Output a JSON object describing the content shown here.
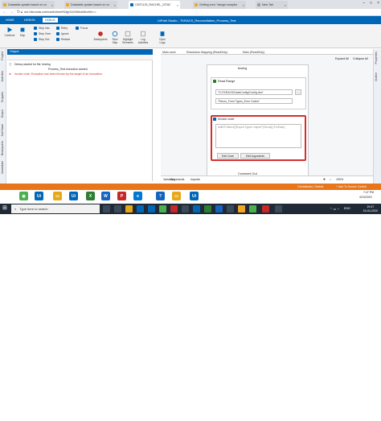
{
  "browser": {
    "tabs": [
      {
        "title": "Datatable update based on co"
      },
      {
        "title": "Datatable update based on co"
      },
      {
        "title": "CMT1125_RACHEL_23782"
      },
      {
        "title": "Getting error \"assign exceptio"
      },
      {
        "title": "New Tab"
      }
    ],
    "url": "ra1.hitconda.com/ca/#/client/N3gGAGMAdzBzcWx=="
  },
  "studio": {
    "ribbon_tabs": [
      "HOME",
      "DESIGN",
      "DEBUG"
    ],
    "title": "UiPath Studio - TKRACS_Reconciliation_Process_Test",
    "ribbon": {
      "continue": "Continue",
      "stop": "Stop",
      "step_into": "Step Into",
      "step_over": "Step Over",
      "step_out": "Step Out",
      "retry": "Retry",
      "ignore": "Ignore",
      "restart": "Restart",
      "focus": "Focus",
      "breakpoints": "Breakpoints",
      "slow_step": "Slow Step",
      "highlight": "Highlight Elements",
      "log_activities": "Log Activities",
      "open_logs": "Open Logs"
    },
    "left_panels": [
      "Project",
      "Activities",
      "Snippets",
      "Output",
      "Call Stack",
      "Breakpoints",
      "Immediate"
    ],
    "right_panels": [
      "Properties",
      "Outline"
    ]
  },
  "output": {
    "title": "Output",
    "lines": [
      {
        "text": "Debuq started for file: testing",
        "color": "#333333"
      },
      {
        "text": "Process_Test execution started",
        "color": "#333333"
      },
      {
        "text": "Invoke code: Exception has been thrown by the target of an invocation.",
        "color": "#d32f2f"
      }
    ]
  },
  "designer": {
    "tabs": [
      "Main.xaml",
      "Resolution Mapping (ReadOnly)",
      "Main (ReadOnly)"
    ],
    "expand_all": "Expand All",
    "collapse_all": "Collapse All",
    "sequence_title": "testing",
    "read_range": {
      "title": "Read Range",
      "path": "\"D:\\TKRACS\\Data\\Config\\Config.xlsx\"",
      "sheet": "\"Recon_Form Types_Error Codes\""
    },
    "invoke_code": {
      "title": "Invoke code",
      "code": "lvdtDT.Select(\"[Export Types: Import\")\\ToList().ForEach(",
      "edit_code": "Edit Code",
      "edit_arguments": "Edit Arguments"
    },
    "next_activity": "Comment Out",
    "bottom_tabs": [
      "Variables",
      "Arguments",
      "Imports"
    ],
    "zoom": "100%"
  },
  "statusbar": {
    "orchestrator": "Orchestrator, Default",
    "source_control": "+ Add To Source Control"
  },
  "remote_clock": {
    "time": "7:47 PM",
    "date": "4/24/2020"
  },
  "taskbar": {
    "search_placeholder": "Type here to search",
    "lang": "ENG",
    "time": "19:47",
    "date": "24-04-2020"
  },
  "colors": {
    "studio_blue": "#0067b8",
    "status_orange": "#e8751a",
    "highlight_red": "#d32f2f",
    "taskbar_dark": "#1f2a36"
  }
}
